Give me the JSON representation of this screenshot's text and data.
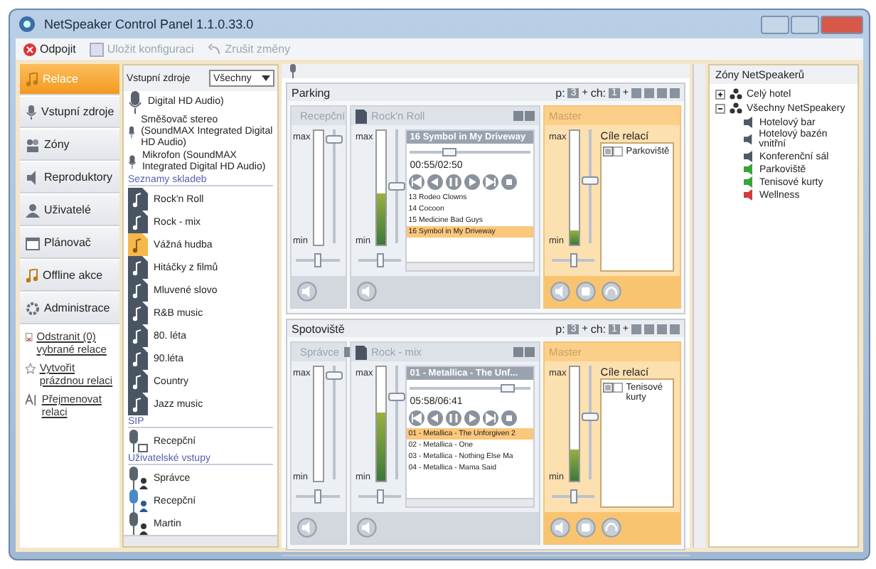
{
  "window": {
    "title": "NetSpeaker Control Panel 1.1.0.33.0"
  },
  "toolbar": [
    {
      "label": "Odpojit",
      "kind": "disconnect",
      "disabled": false
    },
    {
      "label": "Uložit konfiguraci",
      "kind": "save",
      "disabled": true
    },
    {
      "label": "Zrušit změny",
      "kind": "undo",
      "disabled": true
    }
  ],
  "nav": {
    "items": [
      {
        "label": "Relace",
        "kind": "note",
        "selected": true
      },
      {
        "label": "Vstupní zdroje",
        "kind": "mic",
        "selected": false
      },
      {
        "label": "Zóny",
        "kind": "zones",
        "selected": false
      },
      {
        "label": "Reproduktory",
        "kind": "speaker",
        "selected": false
      },
      {
        "label": "Uživatelé",
        "kind": "users",
        "selected": false
      },
      {
        "label": "Plánovač",
        "kind": "calendar",
        "selected": false
      },
      {
        "label": "Offline akce",
        "kind": "note",
        "selected": false
      },
      {
        "label": "Administrace",
        "kind": "gear",
        "selected": false
      }
    ],
    "links": [
      {
        "label": "Odstranit (0) vybrané relace",
        "kind": "delete"
      },
      {
        "label": "Vytvořit prázdnou relaci",
        "kind": "star"
      },
      {
        "label": "Přejmenovat relaci",
        "kind": "rename"
      }
    ]
  },
  "sources": {
    "label": "Vstupní zdroje",
    "filter": "Všechny",
    "groups": [
      {
        "items": [
          {
            "label": "Digital HD Audio)",
            "kind": "mic",
            "selected": false
          },
          {
            "label": "Směšovač stereo (SoundMAX Integrated Digital HD Audio)",
            "kind": "mic",
            "selected": false
          },
          {
            "label": "Mikrofon (SoundMAX Integrated Digital HD Audio)",
            "kind": "mic",
            "selected": false
          }
        ]
      },
      {
        "heading": "Seznamy skladeb",
        "items": [
          {
            "label": "Rock'n Roll",
            "kind": "playlist",
            "selected": false
          },
          {
            "label": "Rock - mix",
            "kind": "playlist",
            "selected": false
          },
          {
            "label": "Vážná hudba",
            "kind": "playlist",
            "selected": true
          },
          {
            "label": "Hitáčky z filmů",
            "kind": "playlist",
            "selected": false
          },
          {
            "label": "Mluvené slovo",
            "kind": "playlist",
            "selected": false
          },
          {
            "label": "R&B music",
            "kind": "playlist",
            "selected": false
          },
          {
            "label": "80. léta",
            "kind": "playlist",
            "selected": false
          },
          {
            "label": "90.léta",
            "kind": "playlist",
            "selected": false
          },
          {
            "label": "Country",
            "kind": "playlist",
            "selected": false
          },
          {
            "label": "Jazz music",
            "kind": "playlist",
            "selected": false
          }
        ]
      },
      {
        "heading": "SIP",
        "items": [
          {
            "label": "Recepční",
            "kind": "sip",
            "selected": false
          }
        ]
      },
      {
        "heading": "Uživatelské vstupy",
        "items": [
          {
            "label": "Správce",
            "kind": "user",
            "selected": false
          },
          {
            "label": "Recepční",
            "kind": "user",
            "selected": true
          },
          {
            "label": "Martin",
            "kind": "user",
            "selected": false
          }
        ]
      }
    ]
  },
  "relations": [
    {
      "name": "Parking",
      "p_label": "p:",
      "p": "3",
      "p_plus": "+",
      "ch_label": "ch:",
      "ch": "1",
      "ch_plus": "+",
      "sources": [
        {
          "kind": "input",
          "title": "Recepční",
          "meter": {
            "max": "max",
            "min": "min",
            "level": 0
          },
          "volume": {
            "level": 0.95
          },
          "balance": {
            "level": 0.5
          }
        },
        {
          "kind": "playlist",
          "title": "Rock'n Roll",
          "now_playing": "16 Symbol in My Driveway",
          "time": "00:55/02:50",
          "progress": {
            "level": 0.3
          },
          "meter": {
            "max": "max",
            "min": "min",
            "level": 0.45
          },
          "volume": {
            "level": 0.5
          },
          "balance": {
            "level": 0.5
          },
          "tracks": [
            {
              "title": "13 Rodeo Clowns",
              "selected": false
            },
            {
              "title": "14 Cocoon",
              "selected": false
            },
            {
              "title": "15 Medicine Bad Guys",
              "selected": false
            },
            {
              "title": "16 Symbol in My Driveway",
              "selected": true
            }
          ]
        }
      ],
      "master": {
        "title": "Master",
        "meter": {
          "max": "max",
          "min": "min",
          "level": 0.12
        },
        "volume": {
          "level": 0.55
        },
        "balance": {
          "level": 0.5
        },
        "targets_label": "Cíle relací",
        "targets": [
          "Parkoviště"
        ]
      }
    },
    {
      "name": "Spotoviště",
      "p_label": "p:",
      "p": "3",
      "p_plus": "+",
      "ch_label": "ch:",
      "ch": "1",
      "ch_plus": "+",
      "sources": [
        {
          "kind": "input",
          "title": "Správce",
          "meter": {
            "max": "max",
            "min": "min",
            "level": 0
          },
          "volume": {
            "level": 0.95
          },
          "balance": {
            "level": 0.5
          }
        },
        {
          "kind": "playlist",
          "title": "Rock - mix",
          "now_playing": "01 - Metallica - The Unf...",
          "time": "05:58/06:41",
          "progress": {
            "level": 0.85
          },
          "meter": {
            "max": "max",
            "min": "min",
            "level": 0.6
          },
          "volume": {
            "level": 0.75
          },
          "balance": {
            "level": 0.5
          },
          "tracks": [
            {
              "title": "01 - Metallica - The Unforgiven 2",
              "selected": true
            },
            {
              "title": "02 - Metallica - One",
              "selected": false
            },
            {
              "title": "03 - Metallica - Nothing Else Ma",
              "selected": false
            },
            {
              "title": "04 - Metallica - Mama Said",
              "selected": false
            }
          ]
        }
      ],
      "master": {
        "title": "Master",
        "meter": {
          "max": "max",
          "min": "min",
          "level": 0.28
        },
        "volume": {
          "level": 0.55
        },
        "balance": {
          "level": 0.5
        },
        "targets_label": "Cíle relací",
        "targets": [
          "Tenisové kurty"
        ]
      }
    }
  ],
  "zones": {
    "title": "Zóny NetSpeakerů",
    "tree": [
      {
        "label": "Celý hotel",
        "expanded": false
      },
      {
        "label": "Všechny NetSpeakery",
        "expanded": true,
        "children": [
          {
            "label": "Hotelový bar",
            "color": "#505a66"
          },
          {
            "label": "Hotelový bazén vnitřní",
            "color": "#505a66"
          },
          {
            "label": "Konferenční sál",
            "color": "#505a66"
          },
          {
            "label": "Parkoviště",
            "color": "#3aa43a"
          },
          {
            "label": "Tenisové kurty",
            "color": "#3aa43a"
          },
          {
            "label": "Wellness",
            "color": "#d23c3c"
          }
        ]
      }
    ]
  }
}
